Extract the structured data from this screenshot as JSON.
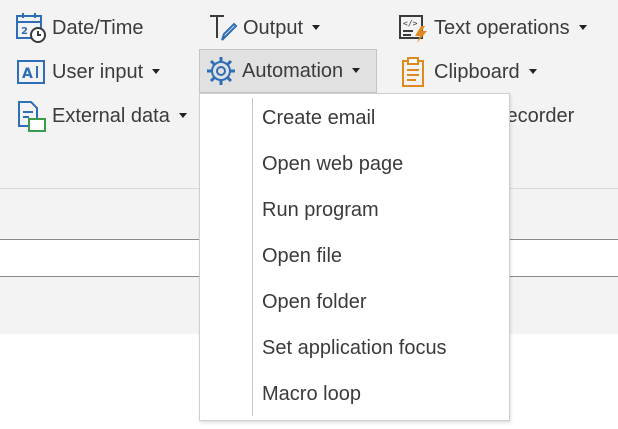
{
  "ribbon": {
    "datetime": {
      "label": "Date/Time",
      "icon": "calendar-clock-icon"
    },
    "output": {
      "label": "Output",
      "icon": "text-pen-icon"
    },
    "text_operations": {
      "label": "Text operations",
      "icon": "code-lightning-icon"
    },
    "user_input": {
      "label": "User input",
      "icon": "input-box-icon"
    },
    "automation": {
      "label": "Automation",
      "icon": "gear-icon"
    },
    "clipboard": {
      "label": "Clipboard",
      "icon": "clipboard-icon"
    },
    "external_data": {
      "label": "External data",
      "icon": "document-folder-icon"
    },
    "recorder": {
      "label": "Recorder"
    }
  },
  "menu": {
    "items": [
      {
        "label": "Create email"
      },
      {
        "label": "Open web page"
      },
      {
        "label": "Run program"
      },
      {
        "label": "Open file"
      },
      {
        "label": "Open folder"
      },
      {
        "label": "Set application focus"
      },
      {
        "label": "Macro loop"
      }
    ]
  },
  "colors": {
    "accent_blue": "#2e6eb6",
    "icon_orange": "#e08a1e",
    "icon_green": "#3a9b4b"
  }
}
